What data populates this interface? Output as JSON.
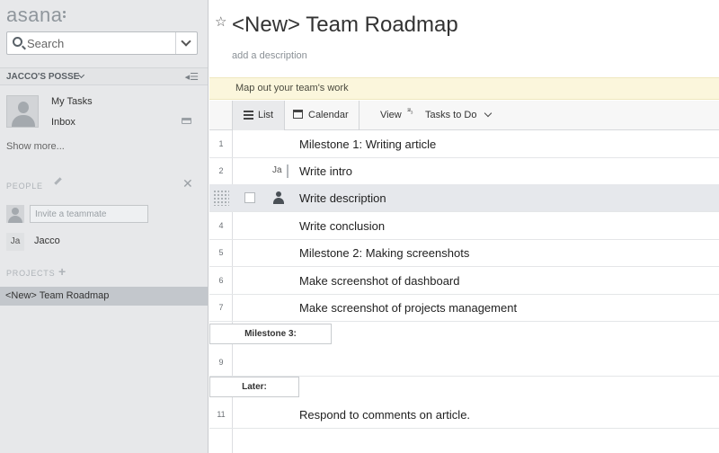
{
  "app": {
    "logo_text": "asana"
  },
  "search": {
    "placeholder": "Search"
  },
  "workspace": {
    "name": "JACCO'S POSSE"
  },
  "nav": {
    "my_tasks": "My Tasks",
    "inbox": "Inbox",
    "show_more": "Show more..."
  },
  "people": {
    "label": "PEOPLE",
    "invite_placeholder": "Invite a teammate",
    "members": [
      {
        "initials": "Ja",
        "name": "Jacco"
      }
    ]
  },
  "projects": {
    "label": "PROJECTS",
    "items": [
      {
        "name": "<New> Team Roadmap",
        "selected": true
      }
    ]
  },
  "project": {
    "title": "<New> Team Roadmap",
    "description": "add a description",
    "banner": "Map out your team's work"
  },
  "toolbar": {
    "list_label": "List",
    "calendar_label": "Calendar",
    "view_label": "View",
    "sort_glyph": "³²₃",
    "view_value": "Tasks to Do"
  },
  "tasks": [
    {
      "num": "1",
      "title": "Milestone 1: Writing article",
      "assignee": ""
    },
    {
      "num": "2",
      "title": "Write intro",
      "assignee": "Ja"
    },
    {
      "num": "",
      "title": "Write description",
      "assignee": "person-icon",
      "highlighted": true
    },
    {
      "num": "4",
      "title": "Write conclusion",
      "assignee": ""
    },
    {
      "num": "5",
      "title": "Milestone 2: Making screenshots",
      "assignee": ""
    },
    {
      "num": "6",
      "title": "Make screenshot of dashboard",
      "assignee": ""
    },
    {
      "num": "7",
      "title": "Make screenshot of projects management",
      "assignee": ""
    },
    {
      "section": "Milestone 3:"
    },
    {
      "num": "9",
      "title": "",
      "assignee": ""
    },
    {
      "section": "Later:"
    },
    {
      "num": "11",
      "title": "Respond to comments on article.",
      "assignee": ""
    }
  ],
  "colors": {
    "sidebar_bg": "#e7e8ea",
    "selected_project": "#c3c7cc",
    "banner_bg": "#fbf6dc",
    "highlight_row": "#e6e8ec"
  }
}
